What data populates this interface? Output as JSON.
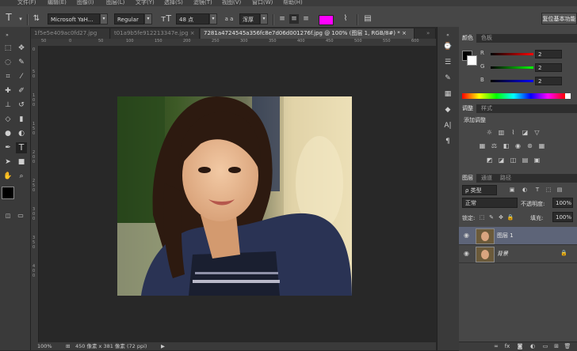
{
  "menu": [
    "文件(F)",
    "编辑(E)",
    "图像(I)",
    "图层(L)",
    "文字(Y)",
    "选择(S)",
    "滤镜(T)",
    "视图(V)",
    "窗口(W)",
    "帮助(H)"
  ],
  "options": {
    "font_family": "Microsoft YaH...",
    "font_style": "Regular",
    "font_size": "48 点",
    "aa_label": "a a",
    "aa_mode": "浑厚",
    "text_color": "#ff00ff",
    "reset_label": "复位基本功能"
  },
  "tabs": [
    {
      "label": "1f5e5e409ac0fd27.jpg"
    },
    {
      "label": "t01a9b5fe912213347e.jpg",
      "close": "×"
    },
    {
      "label": "7281a4724545a356fc8e7d06d001276f.jpg @ 100% (图层 1, RGB/8#) *",
      "close": "×"
    }
  ],
  "ruler": {
    "h": [
      "50",
      "0",
      "50",
      "100",
      "150",
      "200",
      "250",
      "300",
      "350",
      "400",
      "450",
      "500",
      "550",
      "600"
    ],
    "v": [
      "0",
      "5",
      "0",
      "1",
      "0",
      "0",
      "1",
      "5",
      "0",
      "2",
      "0",
      "0",
      "2",
      "5",
      "0",
      "3",
      "0",
      "0",
      "3",
      "5",
      "0",
      "4",
      "0",
      "0"
    ]
  },
  "status": {
    "zoom": "100%",
    "info": "450 像素 x 381 像素 (72 ppi)"
  },
  "color_panel": {
    "tabs": [
      "颜色",
      "色板"
    ],
    "channels": [
      {
        "label": "R",
        "value": "2"
      },
      {
        "label": "G",
        "value": "2"
      },
      {
        "label": "B",
        "value": "2"
      }
    ],
    "foreground": "#000000",
    "background": "#ffffff"
  },
  "adjust_panel": {
    "tabs": [
      "调整",
      "样式"
    ],
    "title": "添加调整"
  },
  "layers_panel": {
    "tabs": [
      "图层",
      "通道",
      "路径"
    ],
    "filter_kind": "ρ 类型",
    "blend_mode": "正常",
    "opacity_label": "不透明度:",
    "opacity": "100%",
    "lock_label": "锁定:",
    "fill_label": "填充:",
    "fill": "100%",
    "layers": [
      {
        "name": "图层 1",
        "selected": true
      },
      {
        "name": "背景",
        "selected": false
      }
    ]
  },
  "colors": {
    "selected_layer": "#5d6478"
  }
}
